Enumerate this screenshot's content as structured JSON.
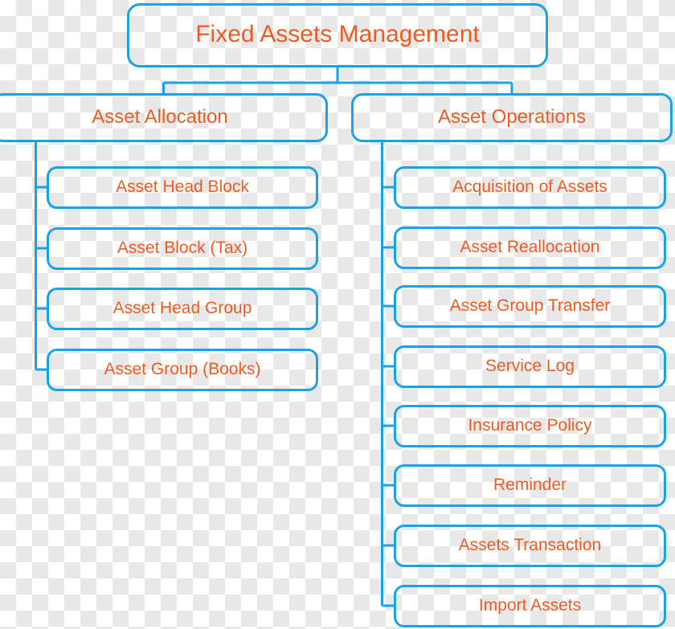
{
  "diagram": {
    "title": "Fixed Assets Management",
    "type": "organization-chart",
    "colors": {
      "border": "#18a2e8",
      "text": "#ef5a21",
      "background_light": "#ffffff",
      "background_dark": "#e8e8e8"
    },
    "root": {
      "label": "Fixed Assets Management"
    },
    "branches": [
      {
        "label": "Asset Allocation",
        "children": [
          {
            "label": "Asset Head Block"
          },
          {
            "label": "Asset Block (Tax)"
          },
          {
            "label": "Asset Head Group"
          },
          {
            "label": "Asset Group (Books)"
          }
        ]
      },
      {
        "label": "Asset Operations",
        "children": [
          {
            "label": "Acquisition of Assets"
          },
          {
            "label": "Asset Reallocation"
          },
          {
            "label": "Asset Group Transfer"
          },
          {
            "label": "Service Log"
          },
          {
            "label": "Insurance Policy"
          },
          {
            "label": "Reminder"
          },
          {
            "label": "Assets Transaction"
          },
          {
            "label": "Import Assets"
          }
        ]
      }
    ]
  }
}
